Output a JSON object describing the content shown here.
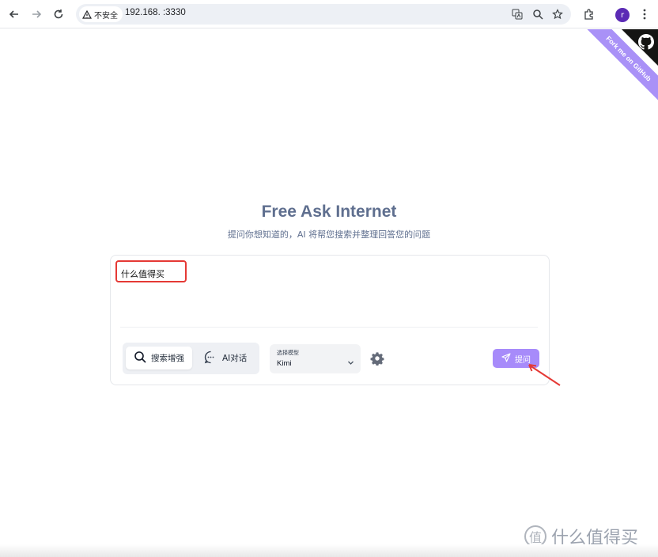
{
  "browser": {
    "security_label": "不安全",
    "url": "192.168.    :3330",
    "avatar_initial": "r"
  },
  "ribbon": {
    "text": "Fork me on GitHub"
  },
  "hero": {
    "title": "Free Ask Internet",
    "subtitle": "提问你想知道的，AI 将帮您搜索并整理回答您的问题"
  },
  "query": {
    "value": "什么值得买"
  },
  "modes": [
    {
      "label": "搜索增强",
      "active": true,
      "icon": "search-icon"
    },
    {
      "label": "AI对话",
      "active": false,
      "icon": "chat-icon"
    }
  ],
  "model": {
    "label": "选择模型",
    "selected": "Kimi"
  },
  "send": {
    "label": "提问"
  },
  "watermark": {
    "text": "什么值得买",
    "logo_char": "值"
  },
  "colors": {
    "accent": "#a78bfa",
    "title": "#5f6f8f",
    "annotation": "#e53935",
    "ribbon": "#a991f7"
  }
}
